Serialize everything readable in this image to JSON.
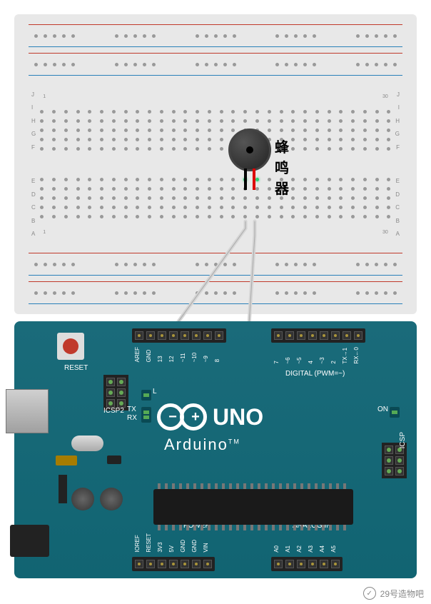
{
  "diagram": {
    "annotation_buzzer": "蜂鸣器",
    "breadboard": {
      "row_labels_upper": [
        "F",
        "G",
        "H",
        "I",
        "J"
      ],
      "row_labels_lower": [
        "A",
        "B",
        "C",
        "D",
        "E"
      ],
      "col_start": "1",
      "col_end": "30"
    }
  },
  "arduino": {
    "board": "UNO",
    "brand": "Arduino",
    "tm": "TM",
    "logo_minus": "−",
    "logo_plus": "+",
    "reset_label": "RESET",
    "digital_label": "DIGITAL (PWM=~)",
    "power_label": "POWER",
    "analog_label": "ANALOG IN",
    "icsp2_label": "ICSP2",
    "icsp1_label": "ICSP",
    "pins": {
      "digital1": [
        "AREF",
        "GND",
        "13",
        "12",
        "~11",
        "~10",
        "~9",
        "8"
      ],
      "digital2": [
        "7",
        "~6",
        "~5",
        "4",
        "~3",
        "2",
        "TX→1",
        "RX←0"
      ],
      "power": [
        "IOREF",
        "RESET",
        "3V3",
        "5V",
        "GND",
        "GND",
        "VIN"
      ],
      "analog": [
        "A0",
        "A1",
        "A2",
        "A3",
        "A4",
        "A5"
      ]
    },
    "leds": {
      "l": "L",
      "tx": "TX",
      "rx": "RX",
      "on": "ON"
    }
  },
  "connections": [
    {
      "from": "buzzer-negative",
      "to": "GND",
      "color": "#d5d5d5"
    },
    {
      "from": "buzzer-positive",
      "to": "8",
      "color": "#d5d5d5"
    }
  ],
  "watermark": {
    "text": "29号造物吧"
  }
}
